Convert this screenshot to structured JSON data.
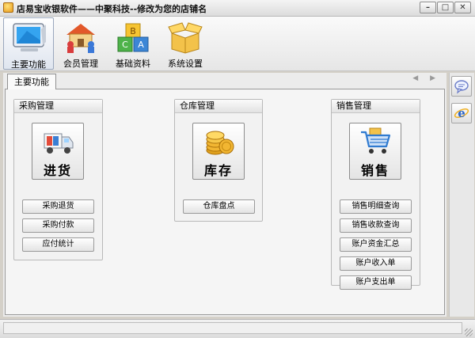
{
  "window": {
    "title": "店易宝收银软件——中聚科技--修改为您的店铺名",
    "min_glyph": "–",
    "max_glyph": "□",
    "close_glyph": "✕"
  },
  "toolbar": {
    "items": [
      {
        "label": "主要功能",
        "icon": "monitor-icon",
        "active": true
      },
      {
        "label": "会员管理",
        "icon": "house-people-icon",
        "active": false
      },
      {
        "label": "基础资料",
        "icon": "abc-blocks-icon",
        "active": false
      },
      {
        "label": "系统设置",
        "icon": "open-box-icon",
        "active": false
      }
    ]
  },
  "tabs": {
    "active_label": "主要功能",
    "scroll_arrows": "◀ ▶"
  },
  "panels": {
    "purchase": {
      "title": "采购管理",
      "main_button": {
        "label": "进货",
        "icon": "delivery-truck-icon"
      },
      "buttons": [
        "采购退货",
        "采购付款",
        "应付统计"
      ]
    },
    "warehouse": {
      "title": "仓库管理",
      "main_button": {
        "label": "库存",
        "icon": "gold-coins-icon"
      },
      "buttons": [
        "仓库盘点"
      ]
    },
    "sales": {
      "title": "销售管理",
      "main_button": {
        "label": "销售",
        "icon": "shopping-cart-icon"
      },
      "buttons": [
        "销售明细查询",
        "销售收款查询",
        "账户资金汇总",
        "账户收入单",
        "账户支出单"
      ]
    }
  },
  "sidebar": {
    "items": [
      {
        "icon": "chat-bubble-icon"
      },
      {
        "icon": "internet-explorer-icon"
      }
    ]
  },
  "colors": {
    "accent_blue": "#2a64c8",
    "coin_gold": "#f2b632",
    "cart_blue": "#2f7ad0"
  }
}
